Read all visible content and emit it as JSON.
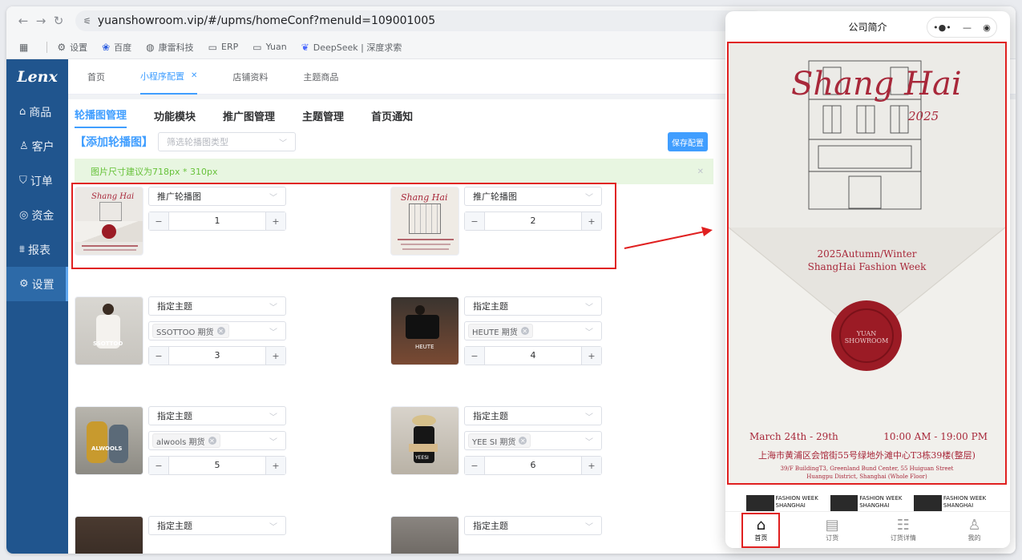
{
  "browser": {
    "url": "yuanshowroom.vip/#/upms/homeConf?menuId=109001005",
    "bookmarks": [
      "设置",
      "百度",
      "康雷科技",
      "ERP",
      "Yuan",
      "DeepSeek | 深度求索"
    ]
  },
  "sidebar": {
    "logo": "Lenx",
    "items": [
      {
        "icon": "⌂",
        "label": "商品"
      },
      {
        "icon": "♙",
        "label": "客户"
      },
      {
        "icon": "⛉",
        "label": "订单"
      },
      {
        "icon": "◎",
        "label": "资金"
      },
      {
        "icon": "⩩",
        "label": "报表"
      },
      {
        "icon": "⚙",
        "label": "设置"
      }
    ]
  },
  "tabs": [
    "首页",
    "小程序配置",
    "店铺资料",
    "主题商品"
  ],
  "subtabs": [
    "轮播图管理",
    "功能模块",
    "推广图管理",
    "主题管理",
    "首页通知"
  ],
  "toolbar": {
    "add_label": "【添加轮播图】",
    "type_placeholder": "筛选轮播图类型",
    "save_label": "保存配置"
  },
  "alert": "图片尺寸建议为718px * 310px",
  "cards": [
    {
      "type": "推广轮播图",
      "tag": "",
      "order": "1"
    },
    {
      "type": "推广轮播图",
      "tag": "",
      "order": "2"
    },
    {
      "type": "指定主题",
      "tag": "SSOTTOO 期货",
      "order": "3"
    },
    {
      "type": "指定主题",
      "tag": "HEUTE 期货",
      "order": "4"
    },
    {
      "type": "指定主题",
      "tag": "alwools 期货",
      "order": "5"
    },
    {
      "type": "指定主题",
      "tag": "YEE SI 期货",
      "order": "6"
    },
    {
      "type": "指定主题",
      "tag": "",
      "order": ""
    },
    {
      "type": "指定主题",
      "tag": "",
      "order": ""
    }
  ],
  "thumb_captions": [
    "SSOTTOO",
    "HEUTE",
    "ALWOOLS",
    "YEESI"
  ],
  "stepper": {
    "minus": "−",
    "plus": "+"
  },
  "phone": {
    "title": "公司简介",
    "poster": {
      "script_title": "Shang Hai",
      "year": "2025",
      "event_line1": "2025Autumn/Winter",
      "event_line2": "ShangHai Fashion Week",
      "seal_text": "YUAN SHOWROOM",
      "date": "March 24th - 29th",
      "time": "10:00 AM - 19:00 PM",
      "address_cn": "上海市黄浦区会馆街55号绿地外滩中心T3栋39楼(整层)",
      "address_en1": "39/F BuildingT3, Greenland Bund Center, 55 Huiguan Street",
      "address_en2": "Huangpu District, Shanghai (Whole Floor)"
    },
    "strip_label": "FASHION WEEK SHANGHAI",
    "nav": [
      {
        "icon": "⌂",
        "label": "首页"
      },
      {
        "icon": "▤",
        "label": "订货"
      },
      {
        "icon": "☷",
        "label": "订货详情"
      },
      {
        "icon": "♙",
        "label": "我的"
      }
    ]
  },
  "colors": {
    "sidebar": "#20558e",
    "accent": "#409eff",
    "highlight": "#e02020",
    "seal": "#9b1b25"
  }
}
